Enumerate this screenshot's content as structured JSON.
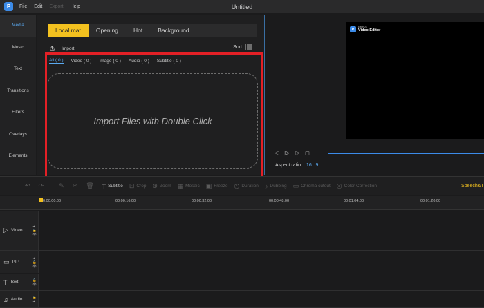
{
  "window": {
    "title": "Untitled",
    "menu": [
      "File",
      "Edit",
      "Export",
      "Help"
    ],
    "logo_text": "P"
  },
  "sidebar": {
    "items": [
      {
        "label": "Media"
      },
      {
        "label": "Music"
      },
      {
        "label": "Text"
      },
      {
        "label": "Transitions"
      },
      {
        "label": "Filters"
      },
      {
        "label": "Overlays"
      },
      {
        "label": "Elements"
      }
    ]
  },
  "media": {
    "tabs": [
      "Local mat",
      "Opening",
      "Hot",
      "Background"
    ],
    "import_label": "Import",
    "sort_label": "Sort",
    "filters": [
      "All ( 0 )",
      "Video ( 0 )",
      "Image ( 0 )",
      "Audio ( 0 )",
      "Subtitle ( 0 )"
    ],
    "drop_text": "Import Files with Double Click"
  },
  "preview": {
    "brand_small": "EaseUS",
    "brand_big": "Video Editor",
    "aspect_label": "Aspect ratio",
    "aspect_value": "16 : 9"
  },
  "toolbar": {
    "subtitle": "Subtitle",
    "crop": "Crop",
    "zoom": "Zoom",
    "mosaic": "Mosaic",
    "freeze": "Freeze",
    "duration": "Duration",
    "dubbing": "Dubbing",
    "chroma": "Chroma cutout",
    "color": "Color Correction",
    "speech": "Speech&T"
  },
  "ruler": {
    "ticks": [
      "00:00:00.00",
      "00:00:16.00",
      "00:00:32.00",
      "00:00:48.00",
      "00:01:04.00",
      "00:01:20.00"
    ]
  },
  "tracks": [
    {
      "label": "Video"
    },
    {
      "label": "PIP"
    },
    {
      "label": "Text"
    },
    {
      "label": "Audio"
    }
  ],
  "colors": {
    "accent_yellow": "#f3c11f",
    "accent_blue": "#5aa9f0",
    "highlight_red": "#e32026"
  }
}
